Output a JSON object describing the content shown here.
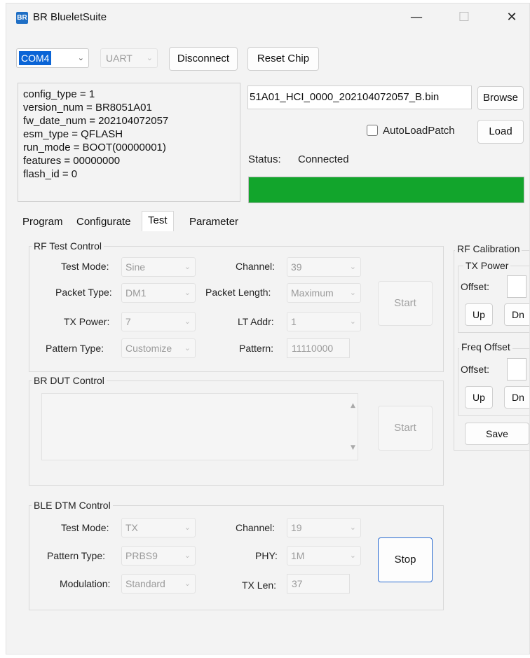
{
  "window": {
    "app_icon_text": "BR",
    "title": "BR BlueletSuite",
    "minimize": "—",
    "maximize": "☐",
    "close": "✕"
  },
  "toolbar": {
    "port": "COM4",
    "interface": "UART",
    "disconnect_label": "Disconnect",
    "reset_label": "Reset Chip"
  },
  "info": [
    "config_type = 1",
    "version_num = BR8051A01",
    "fw_date_num = 202104072057",
    "esm_type = QFLASH",
    "run_mode = BOOT(00000001)",
    "features = 00000000",
    "flash_id = 0"
  ],
  "patch": {
    "path": "51A01_HCI_0000_202104072057_B.bin",
    "browse_label": "Browse",
    "autoload_label": "AutoLoadPatch",
    "autoload_checked": false,
    "load_label": "Load"
  },
  "status": {
    "label": "Status:",
    "value": "Connected",
    "progress": 1.0,
    "progress_color": "#12a52c"
  },
  "tabs": [
    "Program",
    "Configurate",
    "Test",
    "Parameter"
  ],
  "active_tab": "Test",
  "rf_test": {
    "title": "RF Test Control",
    "test_mode_label": "Test Mode:",
    "test_mode": "Sine",
    "channel_label": "Channel:",
    "channel": "39",
    "packet_type_label": "Packet Type:",
    "packet_type": "DM1",
    "packet_length_label": "Packet Length:",
    "packet_length": "Maximum",
    "tx_power_label": "TX Power:",
    "tx_power": "7",
    "lt_addr_label": "LT Addr:",
    "lt_addr": "1",
    "pattern_type_label": "Pattern Type:",
    "pattern_type": "Customize",
    "pattern_label": "Pattern:",
    "pattern": "11110000",
    "start_label": "Start"
  },
  "br_dut": {
    "title": "BR DUT Control",
    "start_label": "Start"
  },
  "ble_dtm": {
    "title": "BLE DTM Control",
    "test_mode_label": "Test Mode:",
    "test_mode": "TX",
    "channel_label": "Channel:",
    "channel": "19",
    "pattern_type_label": "Pattern Type:",
    "pattern_type": "PRBS9",
    "phy_label": "PHY:",
    "phy": "1M",
    "modulation_label": "Modulation:",
    "modulation": "Standard",
    "tx_len_label": "TX Len:",
    "tx_len": "37",
    "stop_label": "Stop"
  },
  "rf_calibration": {
    "title": "RF Calibration",
    "tx_power_title": "TX Power",
    "offset_label": "Offset:",
    "up_label": "Up",
    "dn_label": "Dn",
    "freq_offset_title": "Freq Offset",
    "freq_offset_label": "Offset:",
    "freq_up_label": "Up",
    "freq_dn_label": "Dn",
    "save_label": "Save"
  }
}
